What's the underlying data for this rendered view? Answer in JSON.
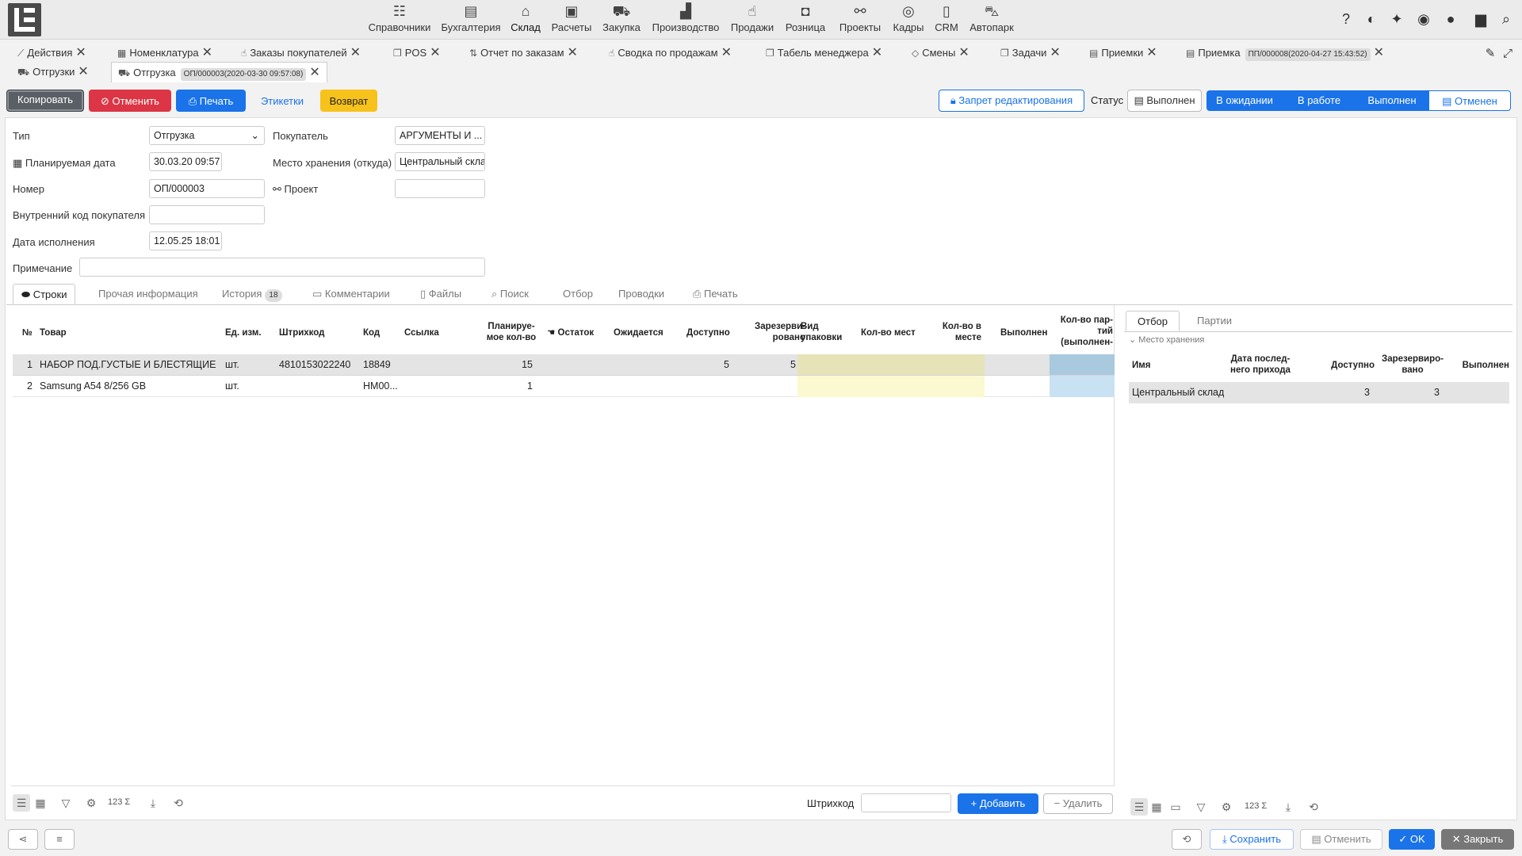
{
  "topnav": {
    "menu": [
      {
        "label": "Справочники",
        "icon": "list-check-icon"
      },
      {
        "label": "Бухгалтерия",
        "icon": "ledger-icon"
      },
      {
        "label": "Склад",
        "icon": "warehouse-icon"
      },
      {
        "label": "Расчеты",
        "icon": "money-icon"
      },
      {
        "label": "Закупка",
        "icon": "cart-icon"
      },
      {
        "label": "Производство",
        "icon": "factory-icon"
      },
      {
        "label": "Продажи",
        "icon": "hand-coin-icon"
      },
      {
        "label": "Розница",
        "icon": "bag-icon"
      },
      {
        "label": "Проекты",
        "icon": "network-icon"
      },
      {
        "label": "Кадры",
        "icon": "fingerprint-icon"
      },
      {
        "label": "CRM",
        "icon": "contact-card-icon"
      },
      {
        "label": "Автопарк",
        "icon": "bus-icon"
      }
    ],
    "active": "Склад",
    "right_icons": [
      "help-icon",
      "contrast-icon",
      "pin-icon",
      "eye-icon",
      "chat-icon",
      "lock-icon",
      "search-icon"
    ]
  },
  "tabs_row1": [
    {
      "label": "Действия",
      "icon": "chart-icon"
    },
    {
      "label": "Номенклатура",
      "icon": "barcode-icon"
    },
    {
      "label": "Заказы покупателей",
      "icon": "hand-coin-icon"
    },
    {
      "label": "POS",
      "icon": "copy-icon"
    },
    {
      "label": "Отчет по заказам",
      "icon": "sort-icon"
    },
    {
      "label": "Сводка по продажам",
      "icon": "hand-coin-icon"
    },
    {
      "label": "Табель менеджера",
      "icon": "copy-icon"
    },
    {
      "label": "Смены",
      "icon": "diamond-icon"
    },
    {
      "label": "Задачи",
      "icon": "copy-icon"
    },
    {
      "label": "Приемки",
      "icon": "doc-icon"
    },
    {
      "label": "Приемка",
      "icon": "doc-icon",
      "badge": "ПП/000008(2020-04-27 15:43:52)"
    }
  ],
  "tabs_row2": [
    {
      "label": "Отгрузки",
      "icon": "truck-icon"
    },
    {
      "label": "Отгрузка",
      "icon": "truck-icon",
      "badge": "ОП/000003(2020-03-30 09:57:08)"
    }
  ],
  "toolbar": {
    "copy": "Копировать",
    "cancel": "Отменить",
    "print": "Печать",
    "labels": "Этикетки",
    "return": "Возврат",
    "edit_lock": "Запрет редактирования",
    "status_label": "Статус",
    "status_value": "Выполнен",
    "steps": [
      "В ожидании",
      "В работе",
      "Выполнен",
      "Отменен"
    ]
  },
  "form": {
    "type_label": "Тип",
    "type_value": "Отгрузка",
    "planned_date_label": "Планируемая дата",
    "planned_date_value": "30.03.20 09:57",
    "number_label": "Номер",
    "number_value": "ОП/000003",
    "internal_code_label": "Внутренний код покупателя",
    "internal_code_value": "",
    "exec_date_label": "Дата исполнения",
    "exec_date_value": "12.05.25 18:01",
    "note_label": "Примечание",
    "note_value": "",
    "buyer_label": "Покупатель",
    "buyer_value": "АРГУМЕНТЫ И ...",
    "storage_label": "Место хранения (откуда)",
    "storage_value": "Центральный скла",
    "project_label": "Проект",
    "project_value": ""
  },
  "subtabs": [
    {
      "label": "Строки",
      "icon": "egg-icon"
    },
    {
      "label": "Прочая информация"
    },
    {
      "label": "История",
      "badge": "18"
    },
    {
      "label": "Комментарии",
      "icon": "comments-icon"
    },
    {
      "label": "Файлы",
      "icon": "file-icon"
    },
    {
      "label": "Поиск",
      "icon": "search-icon"
    },
    {
      "label": "Отбор"
    },
    {
      "label": "Проводки"
    },
    {
      "label": "Печать",
      "icon": "print-icon"
    }
  ],
  "grid": {
    "headers": {
      "num": "№",
      "product": "Товар",
      "unit": "Ед. изм.",
      "barcode": "Штрихкод",
      "code": "Код",
      "link": "Ссылка",
      "planned_l1": "Планируе-",
      "planned_l2": "мое кол-во",
      "rest": "Остаток",
      "expected": "Ожидается",
      "available": "Доступно",
      "reserved_l1": "Зарезерви-",
      "reserved_l2": "ровано",
      "pack_l1": "Вид",
      "pack_l2": "упаковки",
      "places": "Кол-во мест",
      "in_place_l1": "Кол-во в",
      "in_place_l2": "месте",
      "done": "Выполнен",
      "batches_l1": "Кол-во пар-",
      "batches_l2": "тий",
      "batches_l3": "(выполнен-"
    },
    "rows": [
      {
        "num": "1",
        "product": "НАБОР ПОД.ГУСТЫЕ И БЛЕСТЯЩИЕ ...",
        "unit": "шт.",
        "barcode": "4810153022240",
        "code": "18849",
        "planned": "15",
        "available": "5",
        "reserved": "5"
      },
      {
        "num": "2",
        "product": "Samsung A54 8/256 GB",
        "unit": "шт.",
        "barcode": "",
        "code": "НМ00...",
        "planned": "1",
        "available": "",
        "reserved": ""
      }
    ],
    "barcode_label": "Штрихкод",
    "add": "Добавить",
    "delete": "Удалить",
    "footer_icons": [
      "list-view-icon",
      "grid-view-icon",
      "filter-icon",
      "settings-icon",
      "sum-icon",
      "download-icon",
      "refresh-icon"
    ],
    "sum_label": "123 Σ"
  },
  "right_panel": {
    "tabs": [
      "Отбор",
      "Партии"
    ],
    "group": "Место хранения",
    "headers": {
      "name": "Имя",
      "last_l1": "Дата послед-",
      "last_l2": "него прихода",
      "available": "Доступно",
      "reserved_l1": "Зарезервиро-",
      "reserved_l2": "вано",
      "done": "Выполнен"
    },
    "rows": [
      {
        "name": "Центральный склад",
        "available": "3",
        "reserved": "3"
      }
    ],
    "sum_label": "123 Σ"
  },
  "footer": {
    "save": "Сохранить",
    "cancel": "Отменить",
    "ok": "OK",
    "close": "Закрыть"
  }
}
